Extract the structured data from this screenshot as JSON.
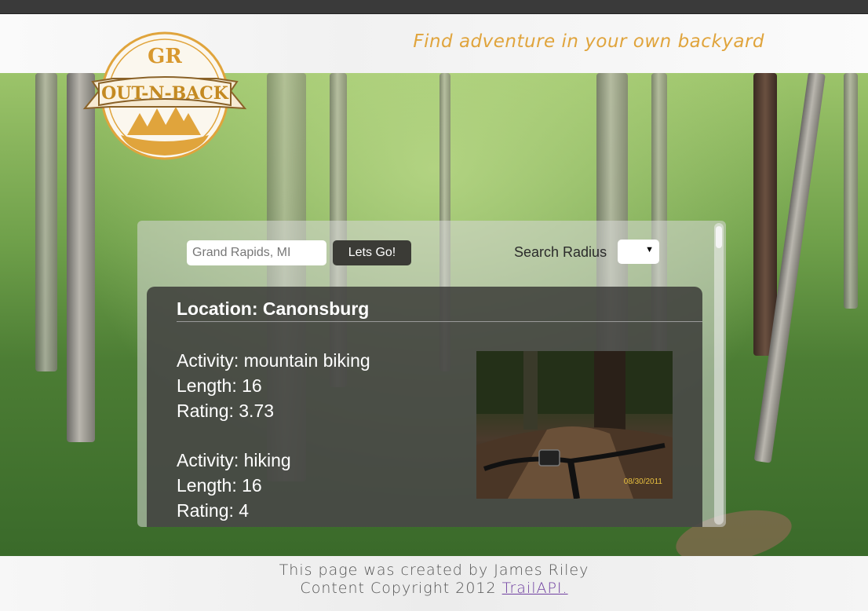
{
  "header": {
    "tagline": "Find adventure in your own backyard",
    "logo": {
      "top_text": "GR",
      "banner_text": "OUT-N-BACK",
      "brand_color": "#e0a43c"
    }
  },
  "search": {
    "placeholder": "Grand Rapids, MI",
    "button_label": "Lets Go!",
    "radius_label": "Search Radius",
    "radius_value": ""
  },
  "result": {
    "location": "Location: Canonsburg",
    "activities": [
      {
        "activity": "Activity: mountain biking",
        "length": "Length: 16",
        "rating": "Rating: 3.73"
      },
      {
        "activity": "Activity: hiking",
        "length": "Length: 16",
        "rating": "Rating: 4"
      }
    ],
    "photo_date": "08/30/2011"
  },
  "footer": {
    "line1": "This page was created by James Riley",
    "line2_prefix": "Content Copyright 2012 ",
    "link_text": "TrailAPI."
  },
  "colors": {
    "accent": "#e0a43c",
    "topbar": "#3a3a3a",
    "button": "#3b3b36",
    "link": "#7040a0"
  }
}
